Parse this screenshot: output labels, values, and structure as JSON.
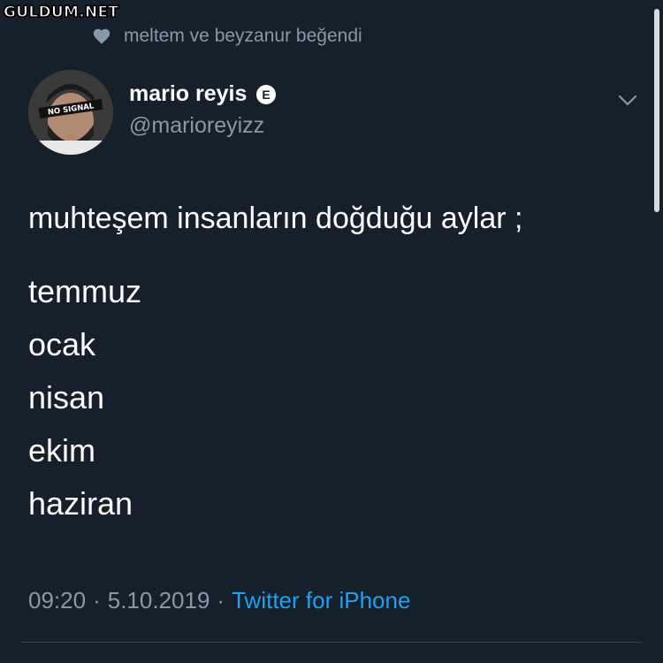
{
  "watermark": "GULDUM.NET",
  "liked_by": "meltem ve beyzanur beğendi",
  "author": {
    "name": "mario reyis",
    "handle": "@marioreyizz",
    "avatar_label": "NO SIGNAL"
  },
  "tweet": {
    "intro": "muhteşem insanların doğduğu aylar ;",
    "months": [
      "temmuz",
      "ocak",
      "nisan",
      "ekim",
      "haziran"
    ]
  },
  "meta": {
    "time": "09:20",
    "sep1": "·",
    "date": "5.10.2019",
    "sep2": "·",
    "source": "Twitter for iPhone"
  },
  "colors": {
    "background": "#15202b",
    "muted": "#8899a6",
    "link": "#1da1f2",
    "text": "#ffffff"
  },
  "icons": {
    "liked": "heart-icon",
    "badge": "e-badge-icon",
    "menu": "chevron-down-icon"
  }
}
